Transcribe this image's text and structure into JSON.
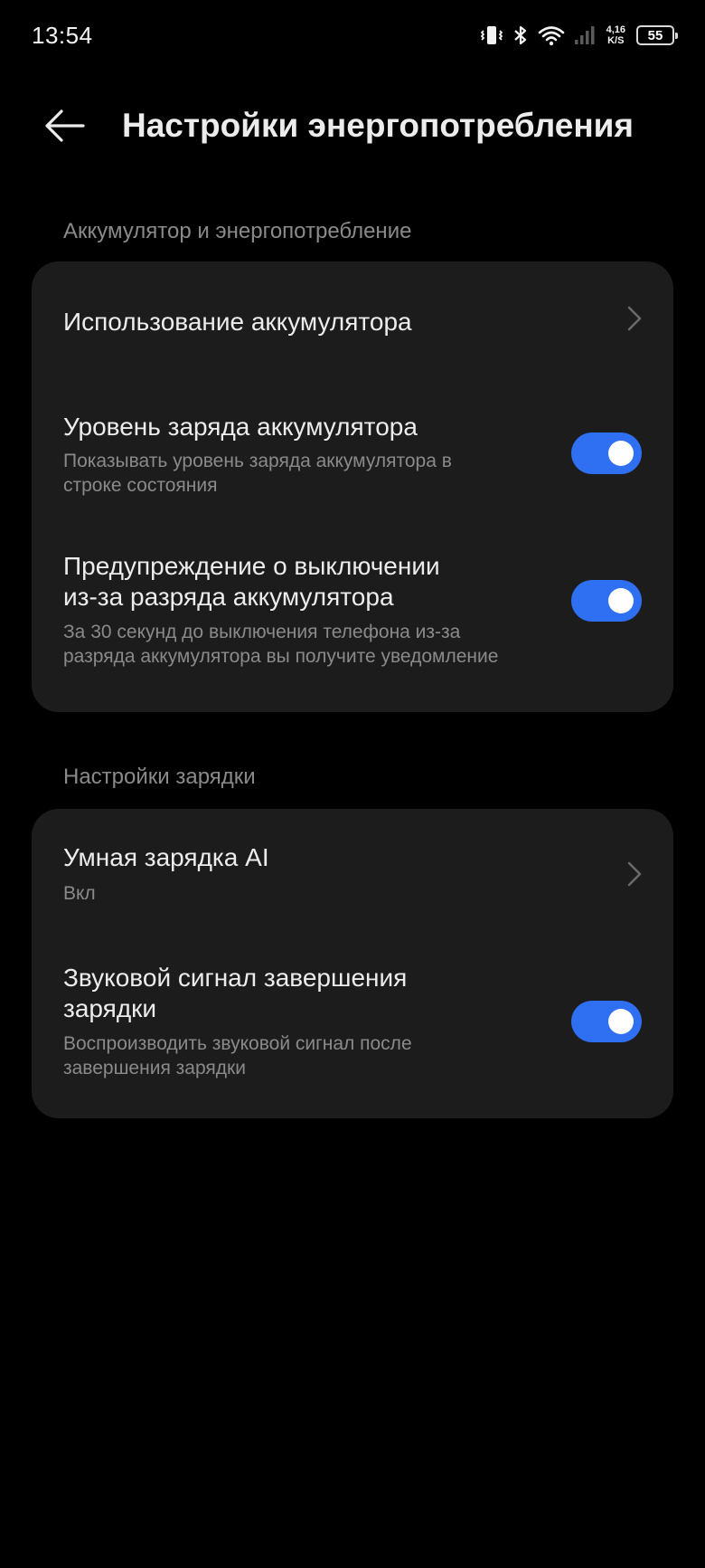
{
  "status_bar": {
    "time": "13:54",
    "net_speed_value": "4,16",
    "net_speed_unit": "K/S",
    "battery_level": "55",
    "icons": [
      "vibrate-icon",
      "bluetooth-icon",
      "wifi-icon",
      "cellular-signal-icon",
      "battery-icon"
    ]
  },
  "header": {
    "title": "Настройки энергопотребления",
    "back_icon": "back-arrow-icon"
  },
  "sections": [
    {
      "label": "Аккумулятор и энергопотребление",
      "items": [
        {
          "title": "Использование аккумулятора",
          "control": "chevron"
        },
        {
          "title": "Уровень заряда аккумулятора",
          "subtitle_line1": "Показывать уровень заряда аккумулятора в",
          "subtitle_line2": "строке состояния",
          "control": "toggle",
          "enabled": true
        },
        {
          "title_line1": "Предупреждение о выключении",
          "title_line2": "из-за разряда аккумулятора",
          "subtitle_line1": "За 30 секунд до выключения телефона из-за",
          "subtitle_line2": "разряда аккумулятора вы получите уведомление",
          "control": "toggle",
          "enabled": true
        }
      ]
    },
    {
      "label": "Настройки зарядки",
      "items": [
        {
          "title": "Умная зарядка AI",
          "subtitle": "Вкл",
          "control": "chevron"
        },
        {
          "title_line1": "Звуковой сигнал завершения",
          "title_line2": "зарядки",
          "subtitle_line1": "Воспроизводить звуковой сигнал после",
          "subtitle_line2": "завершения зарядки",
          "control": "toggle",
          "enabled": true
        }
      ]
    }
  ],
  "colors": {
    "background": "#000000",
    "card": "#1c1c1c",
    "accent": "#2f6ff2",
    "primary_text": "#ececec",
    "secondary_text": "#8a8a8a"
  }
}
